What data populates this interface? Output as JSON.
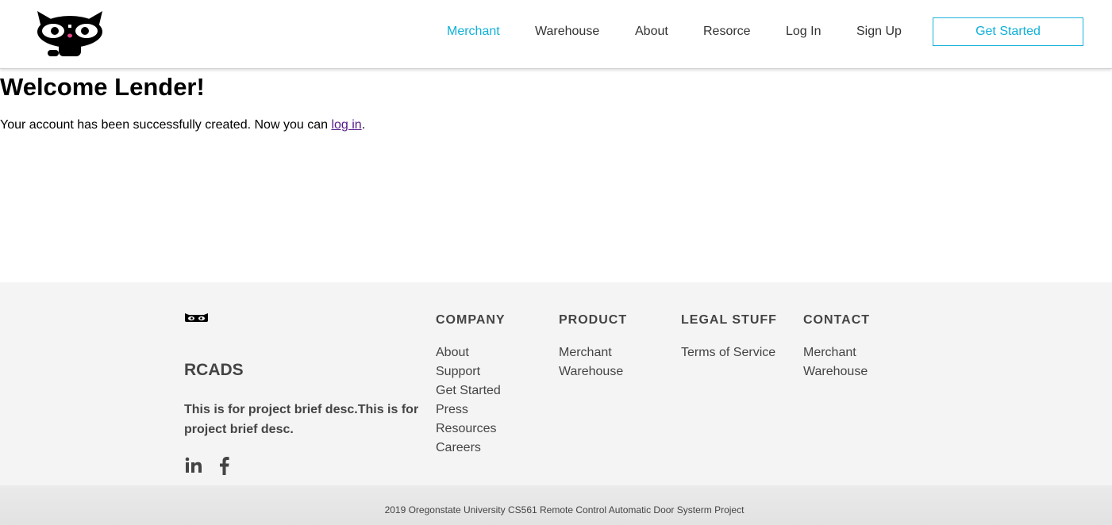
{
  "header": {
    "nav": [
      "Merchant",
      "Warehouse",
      "About",
      "Resorce",
      "Log In",
      "Sign Up"
    ],
    "cta_label": "Get Started",
    "accent_color": "#0fb0d8"
  },
  "main": {
    "title": "Welcome Lender!",
    "message_before": "Your account has been successfully created. Now you can ",
    "login_link": "log in",
    "message_after": "."
  },
  "footer": {
    "brand": "RCADS",
    "description": "This is for project brief desc.This is for project brief desc.",
    "social": [
      "linkedin-icon",
      "facebook-icon"
    ],
    "columns": [
      {
        "title": "COMPANY",
        "links": [
          "About",
          "Support",
          "Get Started",
          "Press",
          "Resources",
          "Careers"
        ]
      },
      {
        "title": "PRODUCT",
        "links": [
          "Merchant",
          "Warehouse"
        ]
      },
      {
        "title": "LEGAL STUFF",
        "links": [
          "Terms of Service"
        ]
      },
      {
        "title": "CONTACT",
        "links": [
          "Merchant",
          "Warehouse"
        ]
      }
    ],
    "copyright": "2019 Oregonstate University CS561 Remote Control Automatic Door Systerm Project"
  }
}
